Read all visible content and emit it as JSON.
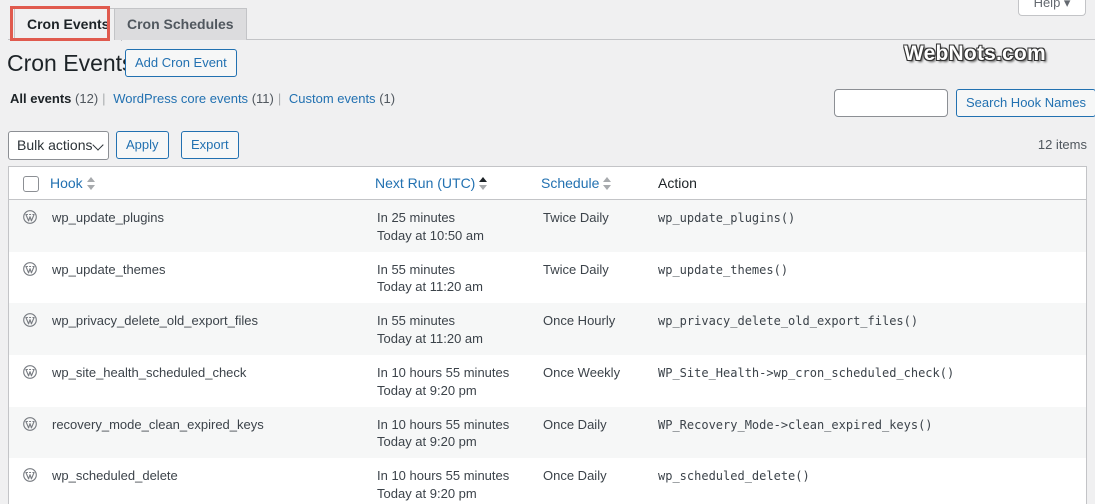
{
  "tabs": [
    {
      "label": "Cron Events",
      "active": true
    },
    {
      "label": "Cron Schedules",
      "active": false
    }
  ],
  "help_label": "Help ▾",
  "page_title": "Cron Events",
  "add_button": "Add Cron Event",
  "watermark": "WebNots.com",
  "filters": {
    "all": "All events",
    "all_count": "(12)",
    "core": "WordPress core events",
    "core_count": "(11)",
    "custom": "Custom events",
    "custom_count": "(1)"
  },
  "search_button": "Search Hook Names",
  "bulk_select": "Bulk actions",
  "apply_button": "Apply",
  "export_button": "Export",
  "items_count": "12 items",
  "columns": {
    "hook": "Hook",
    "next_run": "Next Run (UTC)",
    "schedule": "Schedule",
    "action": "Action"
  },
  "rows": [
    {
      "hook": "wp_update_plugins",
      "next_run": "In 25 minutes",
      "next_time": "Today at 10:50 am",
      "schedule": "Twice Daily",
      "action": "wp_update_plugins()"
    },
    {
      "hook": "wp_update_themes",
      "next_run": "In 55 minutes",
      "next_time": "Today at 11:20 am",
      "schedule": "Twice Daily",
      "action": "wp_update_themes()"
    },
    {
      "hook": "wp_privacy_delete_old_export_files",
      "next_run": "In 55 minutes",
      "next_time": "Today at 11:20 am",
      "schedule": "Once Hourly",
      "action": "wp_privacy_delete_old_export_files()"
    },
    {
      "hook": "wp_site_health_scheduled_check",
      "next_run": "In 10 hours 55 minutes",
      "next_time": "Today at 9:20 pm",
      "schedule": "Once Weekly",
      "action": "WP_Site_Health->wp_cron_scheduled_check()"
    },
    {
      "hook": "recovery_mode_clean_expired_keys",
      "next_run": "In 10 hours 55 minutes",
      "next_time": "Today at 9:20 pm",
      "schedule": "Once Daily",
      "action": "WP_Recovery_Mode->clean_expired_keys()"
    },
    {
      "hook": "wp_scheduled_delete",
      "next_run": "In 10 hours 55 minutes",
      "next_time": "Today at 9:20 pm",
      "schedule": "Once Daily",
      "action": "wp_scheduled_delete()"
    }
  ]
}
